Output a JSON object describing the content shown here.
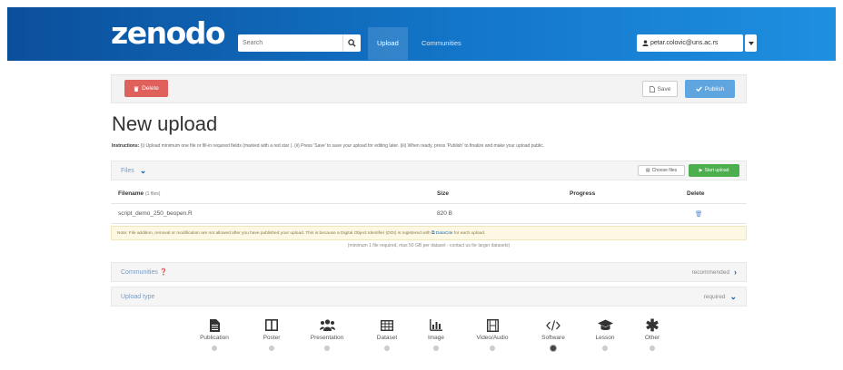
{
  "header": {
    "logo": "zenodo",
    "search_placeholder": "Search",
    "nav": [
      "Upload",
      "Communities"
    ],
    "user_email": "petar.colovic@uns.ac.rs",
    "bg_color": "#1376c9"
  },
  "actions": {
    "delete_label": "Delete",
    "save_label": "Save",
    "publish_label": "Publish"
  },
  "page": {
    "title": "New upload",
    "instructions_label": "Instructions:",
    "instructions_text": "(i) Upload minimum one file or fill-in required fields (marked with a red star ). (ii) Press 'Save' to save your upload for editing later. (iii) When ready, press 'Publish' to finalize and make your upload public."
  },
  "files": {
    "panel_title": "Files",
    "choose_files": "Choose files",
    "start_upload": "Start upload",
    "columns": {
      "filename": "Filename",
      "filename_count": "(1 files)",
      "size": "Size",
      "progress": "Progress",
      "delete": "Delete"
    },
    "rows": [
      {
        "filename": "script_demo_250_beopen.R",
        "size": "820 B",
        "progress": ""
      }
    ],
    "note_text": "Note: File addition, removal or modification are not allowed after you have published your upload. This is because a Digital Object Identifier (DOI) is registered with",
    "note_link": "DataCite",
    "note_tail": "for each upload.",
    "minimum_text": "(minimum 1 file required, max 50 GB per dataset - contact us for larger datasets)"
  },
  "communities": {
    "title": "Communities",
    "status": "recommended"
  },
  "upload_type": {
    "title": "Upload type",
    "status": "required",
    "selected": "Software",
    "options": [
      {
        "label": "Publication",
        "icon": "file-icon"
      },
      {
        "label": "Poster",
        "icon": "columns-icon"
      },
      {
        "label": "Presentation",
        "icon": "group-icon"
      },
      {
        "label": "Dataset",
        "icon": "table-icon"
      },
      {
        "label": "Image",
        "icon": "bar-chart-icon"
      },
      {
        "label": "Video/Audio",
        "icon": "film-icon"
      },
      {
        "label": "Software",
        "icon": "code-icon"
      },
      {
        "label": "Lesson",
        "icon": "graduation-cap-icon"
      },
      {
        "label": "Other",
        "icon": "asterisk-icon"
      }
    ]
  }
}
